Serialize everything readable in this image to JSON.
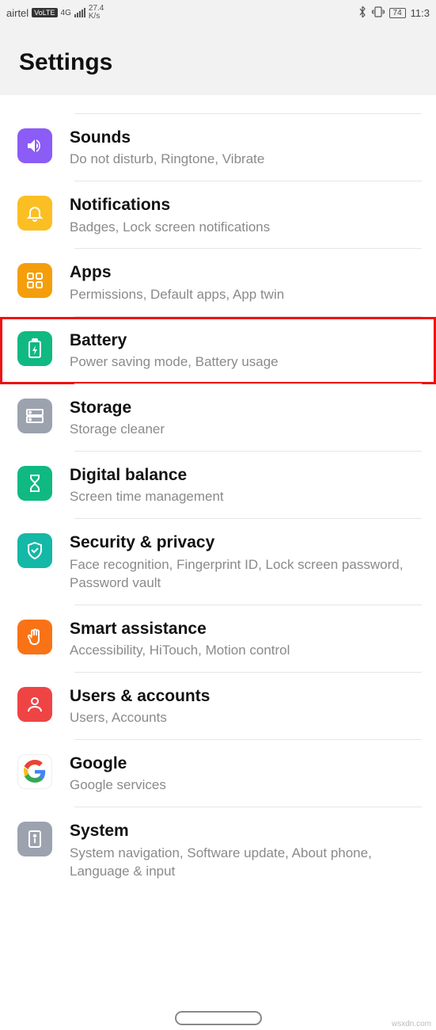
{
  "statusbar": {
    "carrier": "airtel",
    "volte": "VoLTE",
    "network": "4G",
    "speed_top": "27.4",
    "speed_unit": "K/s",
    "battery": "74",
    "clock": "11:3"
  },
  "header": {
    "title": "Settings"
  },
  "items": [
    {
      "title": "Sounds",
      "subtitle": "Do not disturb, Ringtone, Vibrate"
    },
    {
      "title": "Notifications",
      "subtitle": "Badges, Lock screen notifications"
    },
    {
      "title": "Apps",
      "subtitle": "Permissions, Default apps, App twin"
    },
    {
      "title": "Battery",
      "subtitle": "Power saving mode, Battery usage"
    },
    {
      "title": "Storage",
      "subtitle": "Storage cleaner"
    },
    {
      "title": "Digital balance",
      "subtitle": "Screen time management"
    },
    {
      "title": "Security & privacy",
      "subtitle": "Face recognition, Fingerprint ID, Lock screen password, Password vault"
    },
    {
      "title": "Smart assistance",
      "subtitle": "Accessibility, HiTouch, Motion control"
    },
    {
      "title": "Users & accounts",
      "subtitle": "Users, Accounts"
    },
    {
      "title": "Google",
      "subtitle": "Google services"
    },
    {
      "title": "System",
      "subtitle": "System navigation, Software update, About phone, Language & input"
    }
  ],
  "watermark": "wsxdn.com"
}
